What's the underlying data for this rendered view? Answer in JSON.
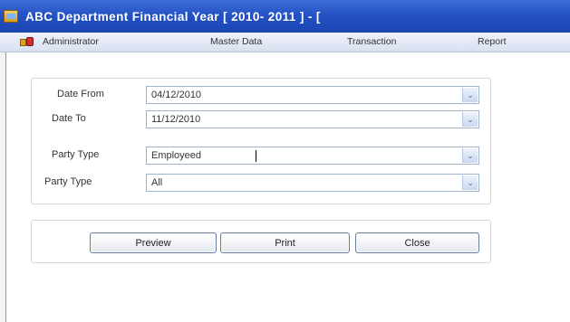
{
  "window": {
    "title": "ABC Department Financial Year [ 2010- 2011 ] - [",
    "icon": "app-window-icon"
  },
  "menu": {
    "icon": "app-menu-icon",
    "items": [
      "Administrator",
      "Master Data",
      "Transaction",
      "Report"
    ]
  },
  "form": {
    "date_from": {
      "label": "Date From",
      "value": "04/12/2010"
    },
    "date_to": {
      "label": "Date To",
      "value": "11/12/2010"
    },
    "party_type_1": {
      "label": "Party Type",
      "value": "Employeed"
    },
    "party_type_2": {
      "label": "Party Type",
      "value": "All"
    }
  },
  "buttons": {
    "preview": "Preview",
    "print": "Print",
    "close": "Close"
  },
  "dropdown_glyph": "⌄",
  "colors": {
    "titlebar": "#2452c4",
    "menubar": "#dfe6f4",
    "combo_border": "#9fb3cf"
  }
}
